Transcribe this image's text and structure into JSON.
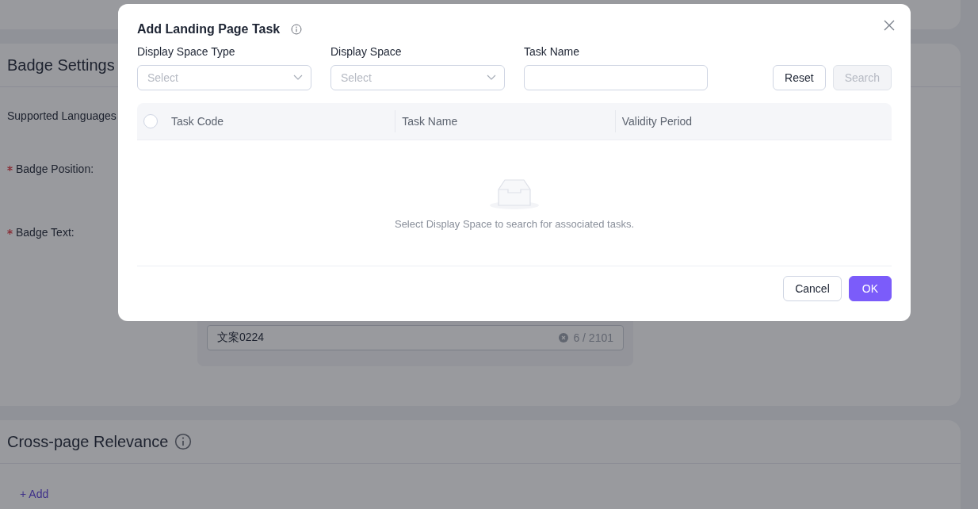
{
  "page": {
    "badge_settings": {
      "title": "Badge Settings",
      "fields": [
        {
          "label": "Supported Languages",
          "required": false
        },
        {
          "label": "Badge Position:",
          "required": true
        },
        {
          "label": "Badge Text:",
          "required": true
        }
      ],
      "badge_text_input": {
        "value": "文案0224",
        "counter": "6 / 2101"
      }
    },
    "cross_page_relevance": {
      "title": "Cross-page Relevance",
      "add_link": "+ Add"
    }
  },
  "dialog": {
    "title": "Add Landing Page Task",
    "filters": [
      {
        "label": "Display Space Type",
        "kind": "select",
        "placeholder": "Select"
      },
      {
        "label": "Display Space",
        "kind": "select",
        "placeholder": "Select"
      },
      {
        "label": "Task Name",
        "kind": "text"
      }
    ],
    "buttons": [
      {
        "label": "Reset",
        "disabled": false
      },
      {
        "label": "Search",
        "disabled": true
      }
    ],
    "table": {
      "select_all_checked": false,
      "columns": [
        "Task Code",
        "Task Name",
        "Validity Period"
      ],
      "empty_text": "Select Display Space to search for associated tasks."
    },
    "footer": [
      {
        "label": "Cancel",
        "kind": "secondary"
      },
      {
        "label": "OK",
        "kind": "primary"
      }
    ]
  }
}
